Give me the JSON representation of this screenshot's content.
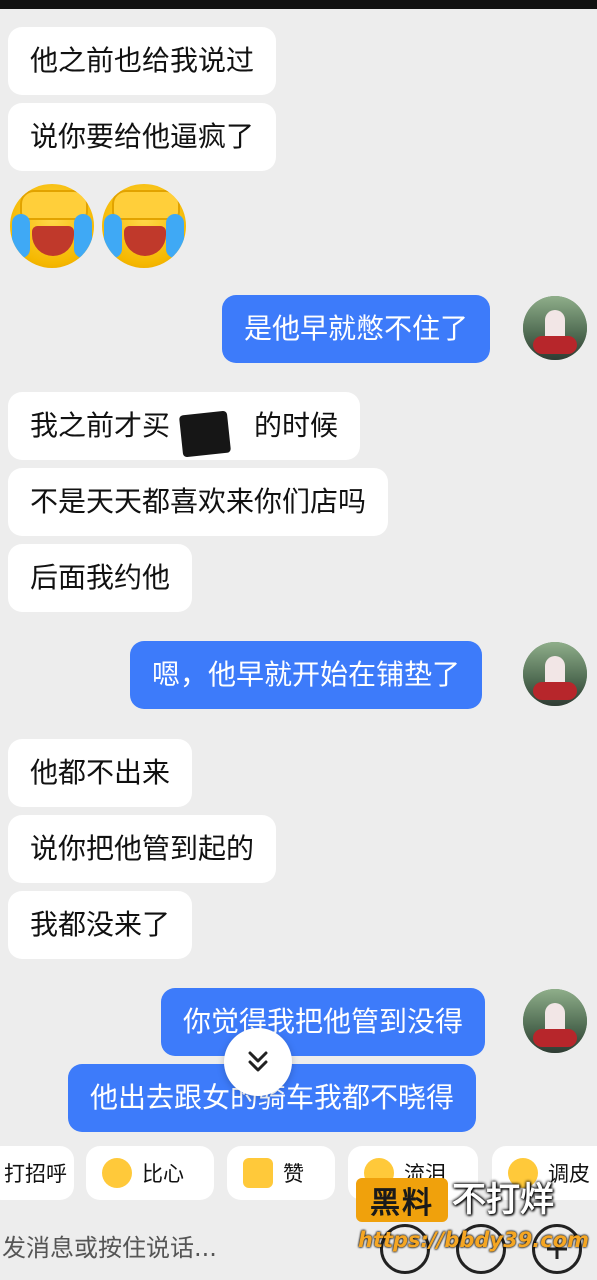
{
  "messages": [
    {
      "side": "in",
      "text": "他之前也给我说过"
    },
    {
      "side": "in",
      "text": "说你要给他逼疯了"
    },
    {
      "side": "out",
      "text": "是他早就憋不住了"
    },
    {
      "side": "in",
      "text": "我之前才买　　　的时候"
    },
    {
      "side": "in",
      "text": "不是天天都喜欢来你们店吗"
    },
    {
      "side": "in",
      "text": "后面我约他"
    },
    {
      "side": "out",
      "text": "嗯，他早就开始在铺垫了"
    },
    {
      "side": "in",
      "text": "他都不出来"
    },
    {
      "side": "in",
      "text": "说你把他管到起的"
    },
    {
      "side": "in",
      "text": "我都没来了"
    },
    {
      "side": "out",
      "text": "你觉得我把他管到没得"
    },
    {
      "side": "out",
      "text": "他出去跟女的骑车我都不晓得"
    }
  ],
  "emoji_message": {
    "icons": [
      "crying-laughing-emoji",
      "crying-laughing-emoji"
    ]
  },
  "quick_replies": [
    {
      "label": "打招呼",
      "icon": ""
    },
    {
      "label": "比心",
      "icon": "heart-hands-emoji"
    },
    {
      "label": "赞",
      "icon": "thumbs-up-emoji"
    },
    {
      "label": "流泪",
      "icon": "crying-emoji"
    },
    {
      "label": "调皮",
      "icon": "tongue-out-emoji"
    }
  ],
  "input": {
    "placeholder": "发消息或按住说话..."
  },
  "watermark": {
    "brand": "黑料",
    "slogan": "不打烊",
    "url": "https://bbdy39.com"
  },
  "colors": {
    "outgoing_bubble": "#3d7bfa",
    "incoming_bubble": "#ffffff",
    "background": "#ededed",
    "watermark_accent": "#f0a10c"
  }
}
